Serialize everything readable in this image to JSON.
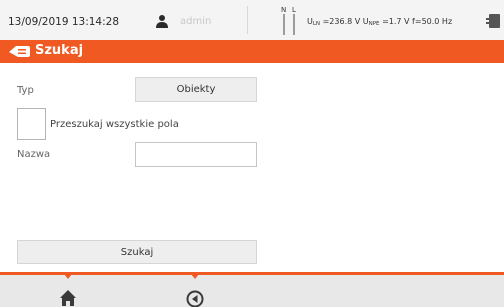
{
  "status": {
    "datetime": "13/09/2019 13:14:28",
    "user": "admin",
    "phase_labels": {
      "n": "N",
      "l": "L"
    },
    "u_ln_label": "U",
    "u_ln_sub": "LN",
    "u_ln_value": " =236.8 V ",
    "u_npe_label": "U",
    "u_npe_sub": "NPE",
    "u_npe_value": " =1.7 V f=50.0 Hz"
  },
  "header": {
    "title": "Szukaj"
  },
  "form": {
    "type_label": "Typ",
    "type_value": "Obiekty",
    "search_all_label": "Przeszukaj wszystkie pola",
    "search_all_checked": false,
    "name_label": "Nazwa",
    "name_value": "",
    "search_button": "Szukaj"
  },
  "colors": {
    "accent": "#f05a22"
  },
  "footer": {
    "icons": [
      "home-icon",
      "back-icon"
    ]
  }
}
